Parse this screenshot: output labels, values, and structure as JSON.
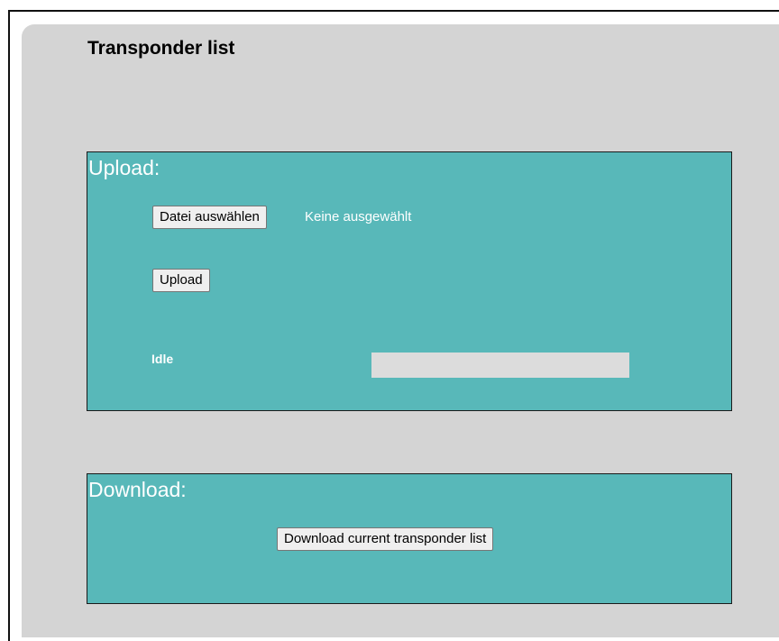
{
  "page": {
    "title": "Transponder list"
  },
  "upload": {
    "title": "Upload:",
    "file_button_label": "Datei auswählen",
    "file_status": "Keine ausgewählt",
    "upload_button_label": "Upload",
    "status_text": "Idle",
    "progress": 0
  },
  "download": {
    "title": "Download:",
    "download_button_label": "Download current transponder list"
  },
  "colors": {
    "panel_background": "#d4d4d4",
    "section_background": "#58b8b9",
    "progress_track": "#dcdcdc"
  }
}
